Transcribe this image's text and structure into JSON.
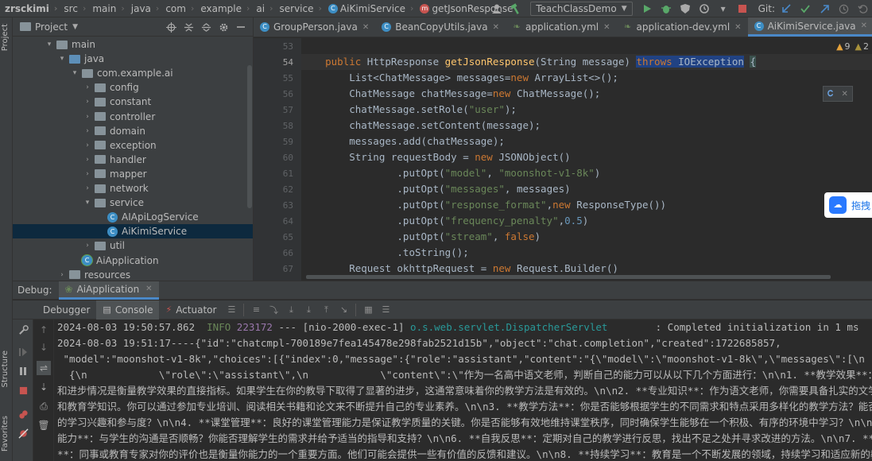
{
  "breadcrumbs": [
    "zrsckimi",
    "src",
    "main",
    "java",
    "com",
    "example",
    "ai",
    "service",
    "AiKimiService",
    "getJsonResponse"
  ],
  "run_config": "TeachClassDemo",
  "git_label": "Git:",
  "left_stripe": {
    "project": "Project",
    "structure": "Structure",
    "favorites": "Favorites"
  },
  "project_panel": {
    "title": "Project",
    "tree": [
      {
        "label": "main",
        "type": "folder",
        "expanded": true
      },
      {
        "label": "java",
        "type": "folder-blue",
        "expanded": true
      },
      {
        "label": "com.example.ai",
        "type": "package",
        "expanded": true
      },
      {
        "label": "config",
        "type": "package",
        "expanded": false
      },
      {
        "label": "constant",
        "type": "package",
        "expanded": false
      },
      {
        "label": "controller",
        "type": "package",
        "expanded": false
      },
      {
        "label": "domain",
        "type": "package",
        "expanded": false
      },
      {
        "label": "exception",
        "type": "package",
        "expanded": false
      },
      {
        "label": "handler",
        "type": "package",
        "expanded": false
      },
      {
        "label": "mapper",
        "type": "package",
        "expanded": false
      },
      {
        "label": "network",
        "type": "package",
        "expanded": false
      },
      {
        "label": "service",
        "type": "package",
        "expanded": true
      },
      {
        "label": "AIApiLogService",
        "type": "class"
      },
      {
        "label": "AiKimiService",
        "type": "class",
        "selected": true
      },
      {
        "label": "util",
        "type": "package",
        "expanded": false
      },
      {
        "label": "AiApplication",
        "type": "app-class"
      },
      {
        "label": "resources",
        "type": "folder",
        "expanded": false
      }
    ]
  },
  "editor": {
    "tabs": [
      {
        "label": "GroupPerson.java",
        "icon": "C",
        "active": false
      },
      {
        "label": "BeanCopyUtils.java",
        "icon": "C",
        "active": false
      },
      {
        "label": "application.yml",
        "icon": "yml",
        "active": false
      },
      {
        "label": "application-dev.yml",
        "icon": "yml",
        "active": false
      },
      {
        "label": "AiKimiService.java",
        "icon": "C",
        "active": true
      }
    ],
    "warnings": {
      "warn_count": "9",
      "weak_count": "2"
    },
    "line_numbers": [
      "53",
      "54",
      "55",
      "56",
      "57",
      "58",
      "59",
      "60",
      "61",
      "62",
      "63",
      "64",
      "65",
      "66",
      "67"
    ],
    "current_line": "54",
    "float_widget_text": "拖拽"
  },
  "debug": {
    "label": "Debug:",
    "session": "AiApplication",
    "tabs": [
      "Debugger",
      "Console",
      "Actuator"
    ],
    "active_tab": "Console",
    "console_lines": [
      "2024-08-03 19:50:57.862  INFO 223172 --- [nio-2000-exec-1] o.s.web.servlet.DispatcherServlet        : Completed initialization in 1 ms",
      "2024-08-03 19:51:17----{\"id\":\"chatcmpl-700189e7fea145478e298fab2521d15b\",\"object\":\"chat.completion\",\"created\":1722685857,",
      " \"model\":\"moonshot-v1-8k\",\"choices\":[{\"index\":0,\"message\":{\"role\":\"assistant\",\"content\":\"{\\\"model\\\":\\\"moonshot-v1-8k\\\",\\\"messages\\\":[\\n",
      "  {\\n            \\\"role\\\":\\\"assistant\\\",\\n            \\\"content\\\":\\\"作为一名高中语文老师，判断自己的能力可以从以下几个方面进行：\\n\\n1. **教学效果**：学生的成",
      "和进步情况是衡量教学效果的直接指标。如果学生在你的教导下取得了显著的进步，这通常意味着你的教学方法是有效的。\\n\\n2. **专业知识**：作为语文老师，你需要具备扎实的文学、语言",
      "和教育学知识。你可以通过参加专业培训、阅读相关书籍和论文来不断提升自己的专业素养。\\n\\n3. **教学方法**：你是否能够根据学生的不同需求和特点采用多样化的教学方法？能否激发学",
      "的学习兴趣和参与度？\\n\\n4. **课堂管理**：良好的课堂管理能力是保证教学质量的关键。你是否能够有效地维持课堂秩序，同时确保学生能够在一个积极、有序的环境中学习？\\n\\n5. **沟",
      "能力**：与学生的沟通是否顺畅？你能否理解学生的需求并给予适当的指导和支持？\\n\\n6. **自我反思**：定期对自己的教学进行反思，找出不足之处并寻求改进的方法。\\n\\n7. **同行评",
      "**：同事或教育专家对你的评价也是衡量你能力的一个重要方面。他们可能会提供一些有价值的反馈和建议。\\n\\n8. **持续学习**：教育是一个不断发展的领域，持续学习和适应新的教育理念"
    ]
  }
}
